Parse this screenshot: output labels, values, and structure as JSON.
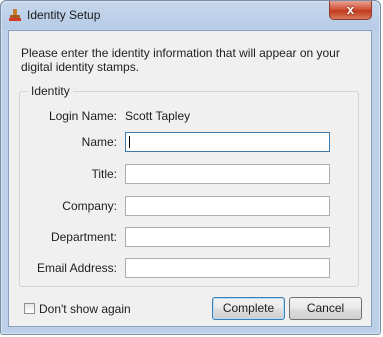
{
  "window": {
    "title": "Identity Setup",
    "close_glyph": "x",
    "app_icon": "stamp-icon"
  },
  "intro": {
    "text": "Please enter the identity information that will appear on your digital identity stamps."
  },
  "identity_group": {
    "legend": "Identity",
    "login_name_label": "Login Name:",
    "login_name_value": "Scott Tapley",
    "fields": [
      {
        "label": "Name:",
        "value": ""
      },
      {
        "label": "Title:",
        "value": ""
      },
      {
        "label": "Company:",
        "value": ""
      },
      {
        "label": "Department:",
        "value": ""
      },
      {
        "label": "Email Address:",
        "value": ""
      }
    ]
  },
  "footer": {
    "dont_show_label": "Don't show again",
    "dont_show_checked": false,
    "complete_label": "Complete",
    "cancel_label": "Cancel"
  },
  "colors": {
    "frame": "#b9cde8",
    "close_button": "#c7452a",
    "default_button_border": "#3c7fb1"
  }
}
